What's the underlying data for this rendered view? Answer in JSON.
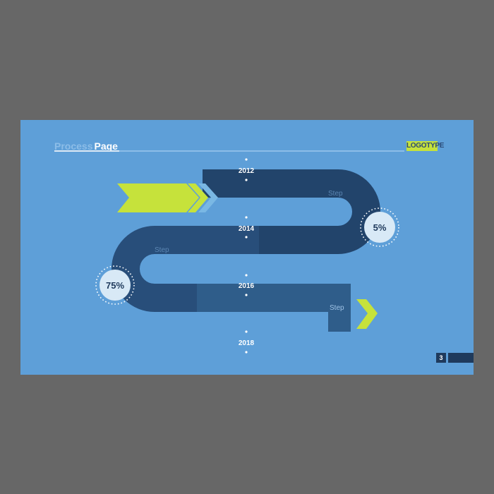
{
  "header": {
    "title_faded": "Process",
    "title_main": "Page",
    "logo_text": "LOGOTYPE"
  },
  "timeline": {
    "years": [
      "2012",
      "2014",
      "2016",
      "2018"
    ]
  },
  "steps": [
    {
      "label": "Step"
    },
    {
      "label": "Step"
    },
    {
      "label": "Step"
    }
  ],
  "progress": [
    {
      "text": "5%",
      "value": 5
    },
    {
      "text": "75%",
      "value": 75
    }
  ],
  "footer": {
    "page_number": "3"
  },
  "colors": {
    "background": "#5e9fd8",
    "track_dark": "#22446b",
    "track_mid": "#284e7a",
    "track_light": "#2f5d8a",
    "accent": "#c6e23b",
    "circle_fill": "#d8e9f6",
    "circle_text": "#1f3a5c"
  }
}
